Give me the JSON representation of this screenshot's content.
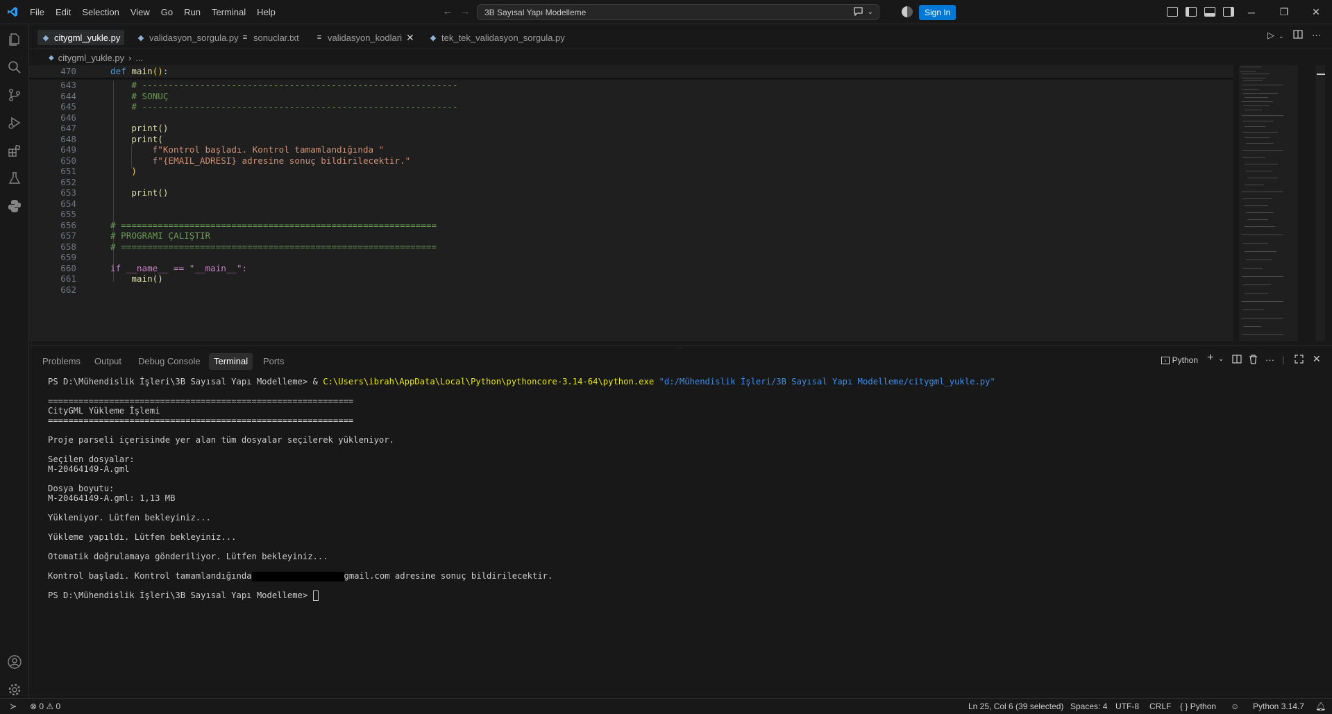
{
  "titlebar": {
    "menu": [
      "File",
      "Edit",
      "Selection",
      "View",
      "Go",
      "Run",
      "Terminal",
      "Help"
    ],
    "search_text": "3B Sayısal Yapı Modelleme",
    "signin_label": "Sign In"
  },
  "tabs": [
    {
      "label": "citygml_yukle.py",
      "active": true,
      "kind": "python"
    },
    {
      "label": "validasyon_sorgula.py",
      "active": false,
      "kind": "python"
    },
    {
      "label": "sonuclar.txt",
      "active": false,
      "kind": "text"
    },
    {
      "label": "validasyon_kodlari",
      "active": false,
      "kind": "text",
      "closable": true
    },
    {
      "label": "tek_tek_validasyon_sorgula.py",
      "active": false,
      "kind": "python"
    }
  ],
  "breadcrumb": {
    "file": "citygml_yukle.py",
    "rest": "..."
  },
  "editor": {
    "sticky": {
      "line": "470",
      "text": "def main():"
    },
    "lines": [
      {
        "n": "643",
        "text": "    # ------------------------------------------------------------"
      },
      {
        "n": "644",
        "text": "    # SONUÇ"
      },
      {
        "n": "645",
        "text": "    # ------------------------------------------------------------"
      },
      {
        "n": "646",
        "text": ""
      },
      {
        "n": "647",
        "text": "    print()"
      },
      {
        "n": "648",
        "text": "    print("
      },
      {
        "n": "649",
        "text": "        f\"Kontrol başladı. Kontrol tamamlandığında \""
      },
      {
        "n": "650",
        "text": "        f\"{EMAIL_ADRESI} adresine sonuç bildirilecektir.\""
      },
      {
        "n": "651",
        "text": "    )"
      },
      {
        "n": "652",
        "text": ""
      },
      {
        "n": "653",
        "text": "    print()"
      },
      {
        "n": "654",
        "text": ""
      },
      {
        "n": "655",
        "text": ""
      },
      {
        "n": "656",
        "text": "# ============================================================"
      },
      {
        "n": "657",
        "text": "# PROGRAMI ÇALIŞTIR"
      },
      {
        "n": "658",
        "text": "# ============================================================"
      },
      {
        "n": "659",
        "text": ""
      },
      {
        "n": "660",
        "text": "if __name__ == \"__main__\":"
      },
      {
        "n": "661",
        "text": "    main()"
      },
      {
        "n": "662",
        "text": ""
      }
    ]
  },
  "panel": {
    "tabs": [
      "Problems",
      "Output",
      "Debug Console",
      "Terminal",
      "Ports"
    ],
    "active_tab": "Terminal",
    "shell_label": "Python"
  },
  "terminal": {
    "prompt": "PS D:\\Mühendislik İşleri\\3B Sayısal Yapı Modelleme>",
    "cmd_amp": " & ",
    "cmd_exe": "C:\\Users\\ibrah\\AppData\\Local\\Python\\pythoncore-3.14-64\\python.exe",
    "cmd_arg": "\"d:/Mühendislik İşleri/3B Sayısal Yapı Modelleme/citygml_yukle.py\"",
    "rule": "============================================================",
    "heading": "CityGML Yükleme İşlemi",
    "l1": "Proje parseli içerisinde yer alan tüm dosyalar seçilerek yükleniyor.",
    "l2": "Seçilen dosyalar:",
    "l3": "M-20464149-A.gml",
    "l4": "Dosya boyutu:",
    "l5": "M-20464149-A.gml: 1,13 MB",
    "l6": "Yükleniyor. Lütfen bekleyiniz...",
    "l7": "Yükleme yapıldı. Lütfen bekleyiniz...",
    "l8": "Otomatik doğrulamaya gönderiliyor. Lütfen bekleyiniz...",
    "l9a": "Kontrol başladı. Kontrol tamamlandığında",
    "l9b": "gmail.com adresine sonuç bildirilecektir."
  },
  "statusbar": {
    "errors": "0",
    "warnings": "0",
    "position": "Ln 25, Col 6 (39 selected)",
    "spaces": "Spaces: 4",
    "encoding": "UTF-8",
    "eol": "CRLF",
    "language": "Python",
    "interpreter": "Python 3.14.7"
  },
  "colors": {
    "accent": "#0078d4",
    "editor_bg": "#1f1f1f",
    "chrome_bg": "#181818"
  }
}
